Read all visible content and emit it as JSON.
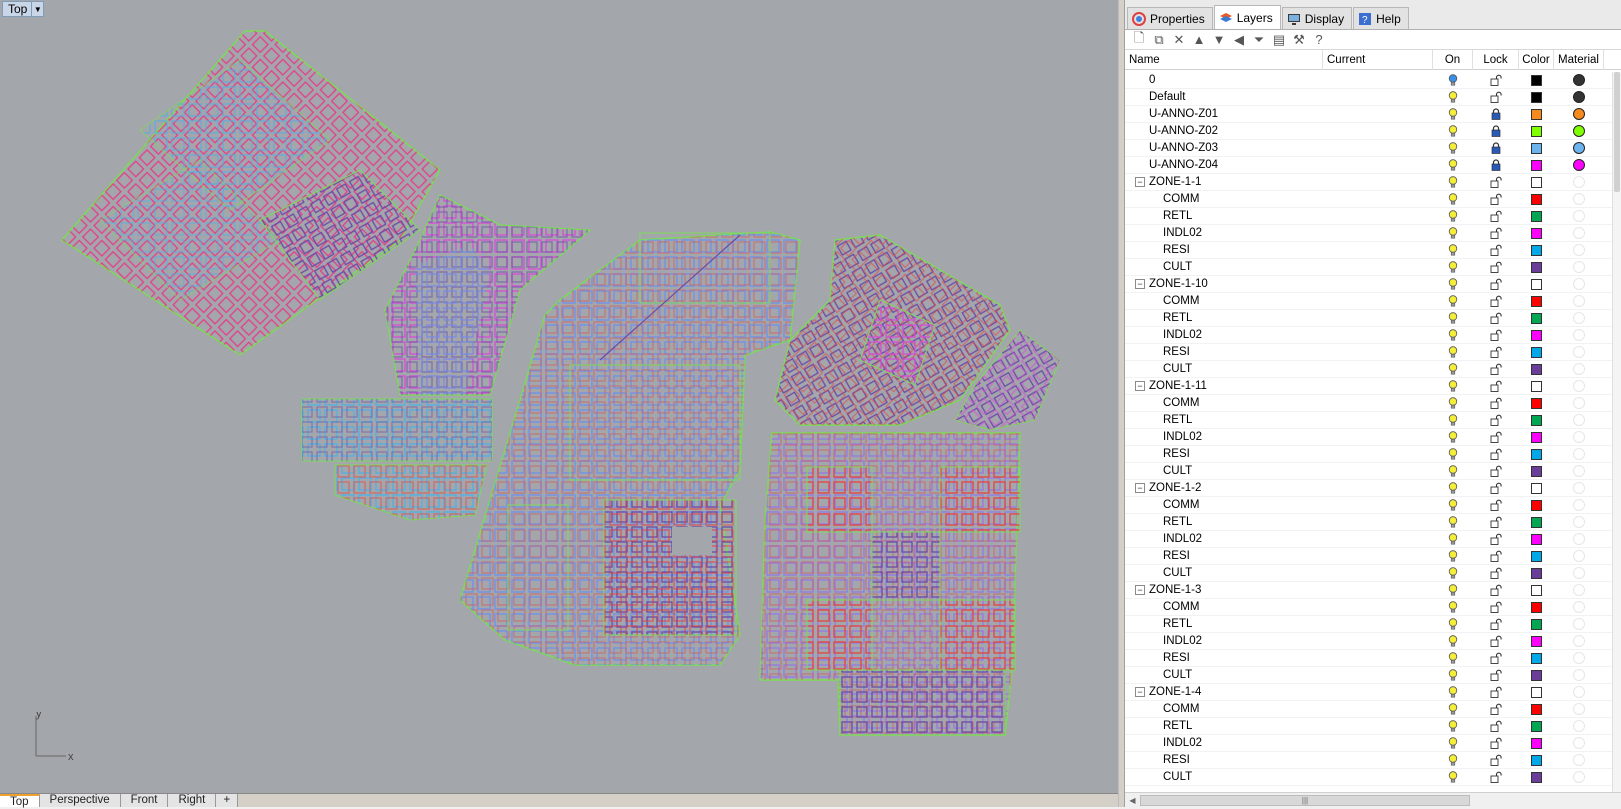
{
  "viewport": {
    "title": "Top",
    "axis_y": "y",
    "axis_x": "x",
    "tabs": [
      {
        "label": "Top",
        "active": true
      },
      {
        "label": "Perspective",
        "active": false
      },
      {
        "label": "Front",
        "active": false
      },
      {
        "label": "Right",
        "active": false
      }
    ],
    "add_tab_icon": "+"
  },
  "panel": {
    "tabs": [
      {
        "label": "Properties",
        "icon": "properties-icon"
      },
      {
        "label": "Layers",
        "icon": "layers-icon",
        "active": true
      },
      {
        "label": "Display",
        "icon": "display-icon"
      },
      {
        "label": "Help",
        "icon": "help-icon"
      }
    ],
    "toolbar": [
      "new-layer-icon",
      "new-sublayer-icon",
      "delete-icon",
      "move-up-icon",
      "move-down-icon",
      "move-left-icon",
      "filter-icon",
      "page-icon",
      "tools-icon",
      "help-icon"
    ],
    "columns": {
      "name": "Name",
      "current": "Current",
      "on": "On",
      "lock": "Lock",
      "color": "Color",
      "material": "Material"
    },
    "colors": {
      "black": "#000000",
      "orange": "#f58a1f",
      "lime": "#7fff00",
      "lightblue": "#6cb4ee",
      "magenta": "#ff00ff",
      "white": "#ffffff",
      "red": "#ff0000",
      "green": "#00a651",
      "pink": "#ff00ff",
      "cyan": "#00a8e8",
      "purple": "#6a3d9a"
    },
    "layers": [
      {
        "name": "0",
        "level": 0,
        "current": true,
        "locked": false,
        "color": "#000000",
        "mat": "#333333"
      },
      {
        "name": "Default",
        "level": 0,
        "locked": false,
        "color": "#000000",
        "mat": "#333333"
      },
      {
        "name": "U-ANNO-Z01",
        "level": 0,
        "locked": true,
        "color": "#f58a1f",
        "mat": "#f58a1f"
      },
      {
        "name": "U-ANNO-Z02",
        "level": 0,
        "locked": true,
        "color": "#7fff00",
        "mat": "#7fff00"
      },
      {
        "name": "U-ANNO-Z03",
        "level": 0,
        "locked": true,
        "color": "#6cb4ee",
        "mat": "#6cb4ee"
      },
      {
        "name": "U-ANNO-Z04",
        "level": 0,
        "locked": true,
        "color": "#ff00ff",
        "mat": "#ff00ff"
      },
      {
        "name": "ZONE-1-1",
        "level": 0,
        "group": true,
        "color": "#ffffff"
      },
      {
        "name": "COMM",
        "level": 1,
        "color": "#ff0000"
      },
      {
        "name": "RETL",
        "level": 1,
        "color": "#00a651"
      },
      {
        "name": "INDL02",
        "level": 1,
        "color": "#ff00ff"
      },
      {
        "name": "RESI",
        "level": 1,
        "color": "#00a8e8"
      },
      {
        "name": "CULT",
        "level": 1,
        "color": "#6a3d9a"
      },
      {
        "name": "ZONE-1-10",
        "level": 0,
        "group": true,
        "color": "#ffffff"
      },
      {
        "name": "COMM",
        "level": 1,
        "color": "#ff0000"
      },
      {
        "name": "RETL",
        "level": 1,
        "color": "#00a651"
      },
      {
        "name": "INDL02",
        "level": 1,
        "color": "#ff00ff"
      },
      {
        "name": "RESI",
        "level": 1,
        "color": "#00a8e8"
      },
      {
        "name": "CULT",
        "level": 1,
        "color": "#6a3d9a"
      },
      {
        "name": "ZONE-1-11",
        "level": 0,
        "group": true,
        "color": "#ffffff"
      },
      {
        "name": "COMM",
        "level": 1,
        "color": "#ff0000"
      },
      {
        "name": "RETL",
        "level": 1,
        "color": "#00a651"
      },
      {
        "name": "INDL02",
        "level": 1,
        "color": "#ff00ff"
      },
      {
        "name": "RESI",
        "level": 1,
        "color": "#00a8e8"
      },
      {
        "name": "CULT",
        "level": 1,
        "color": "#6a3d9a"
      },
      {
        "name": "ZONE-1-2",
        "level": 0,
        "group": true,
        "color": "#ffffff"
      },
      {
        "name": "COMM",
        "level": 1,
        "color": "#ff0000"
      },
      {
        "name": "RETL",
        "level": 1,
        "color": "#00a651"
      },
      {
        "name": "INDL02",
        "level": 1,
        "color": "#ff00ff"
      },
      {
        "name": "RESI",
        "level": 1,
        "color": "#00a8e8"
      },
      {
        "name": "CULT",
        "level": 1,
        "color": "#6a3d9a"
      },
      {
        "name": "ZONE-1-3",
        "level": 0,
        "group": true,
        "color": "#ffffff"
      },
      {
        "name": "COMM",
        "level": 1,
        "color": "#ff0000"
      },
      {
        "name": "RETL",
        "level": 1,
        "color": "#00a651"
      },
      {
        "name": "INDL02",
        "level": 1,
        "color": "#ff00ff"
      },
      {
        "name": "RESI",
        "level": 1,
        "color": "#00a8e8"
      },
      {
        "name": "CULT",
        "level": 1,
        "color": "#6a3d9a"
      },
      {
        "name": "ZONE-1-4",
        "level": 0,
        "group": true,
        "color": "#ffffff"
      },
      {
        "name": "COMM",
        "level": 1,
        "color": "#ff0000"
      },
      {
        "name": "RETL",
        "level": 1,
        "color": "#00a651"
      },
      {
        "name": "INDL02",
        "level": 1,
        "color": "#ff00ff"
      },
      {
        "name": "RESI",
        "level": 1,
        "color": "#00a8e8"
      },
      {
        "name": "CULT",
        "level": 1,
        "color": "#6a3d9a"
      }
    ]
  }
}
